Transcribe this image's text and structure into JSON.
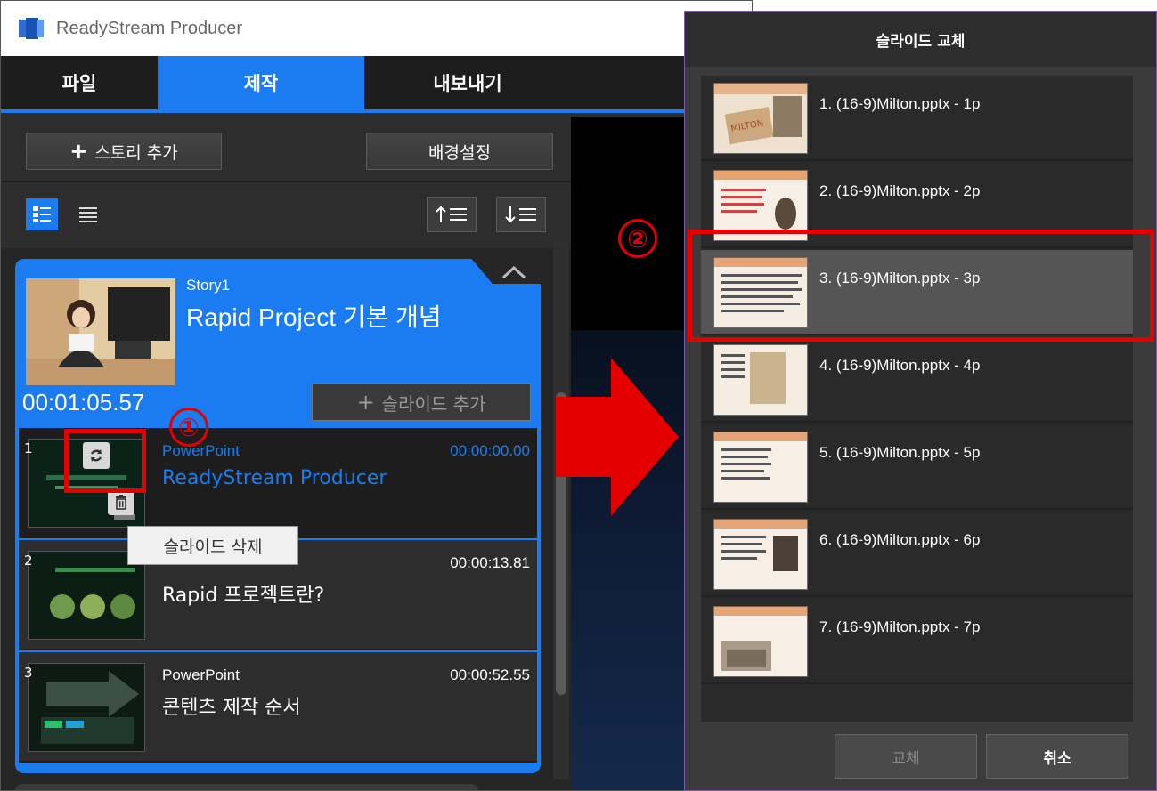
{
  "app": {
    "title": "ReadyStream Producer"
  },
  "tabs": [
    {
      "label": "파일",
      "active": false
    },
    {
      "label": "제작",
      "active": true
    },
    {
      "label": "내보내기",
      "active": false
    }
  ],
  "toolbar": {
    "add_story_label": "스토리 추가",
    "add_story_plus": "+",
    "background_settings_label": "배경설정"
  },
  "story": {
    "label": "Story1",
    "title": "Rapid Project 기본 개념",
    "duration": "00:01:05.57",
    "add_slide_label": "슬라이드 추가",
    "add_slide_plus": "+",
    "slides": [
      {
        "number": "1",
        "kind": "PowerPoint",
        "name": "ReadyStream Producer",
        "duration": "00:00:00.00",
        "selected": true
      },
      {
        "number": "2",
        "kind": "",
        "name": "Rapid 프로젝트란?",
        "duration": "00:00:13.81",
        "selected": false
      },
      {
        "number": "3",
        "kind": "PowerPoint",
        "name": "콘텐츠 제작 순서",
        "duration": "00:00:52.55",
        "selected": false
      }
    ]
  },
  "tooltip": {
    "text": "슬라이드 삭제"
  },
  "annotations": {
    "step1": "①",
    "step2": "②",
    "color": "#e50000"
  },
  "dialog": {
    "title": "슬라이드 교체",
    "items": [
      {
        "label": "1. (16-9)Milton.pptx - 1p",
        "selected": false,
        "thumb_text": "MILTON"
      },
      {
        "label": "2. (16-9)Milton.pptx - 2p",
        "selected": false
      },
      {
        "label": "3. (16-9)Milton.pptx - 3p",
        "selected": true
      },
      {
        "label": "4. (16-9)Milton.pptx - 4p",
        "selected": false
      },
      {
        "label": "5. (16-9)Milton.pptx - 5p",
        "selected": false
      },
      {
        "label": "6. (16-9)Milton.pptx - 6p",
        "selected": false
      },
      {
        "label": "7. (16-9)Milton.pptx - 7p",
        "selected": false
      }
    ],
    "replace_label": "교체",
    "cancel_label": "취소"
  },
  "colors": {
    "accent": "#1a7cf0",
    "panel": "#2d2d2d",
    "annotation": "#e50000"
  },
  "icons": {
    "replace": "refresh-icon",
    "delete": "trash-icon",
    "collapse": "chevron-up-icon",
    "sort_up": "sort-up-icon",
    "sort_down": "sort-down-icon",
    "view_detail": "detail-view-icon",
    "view_list": "list-view-icon"
  }
}
